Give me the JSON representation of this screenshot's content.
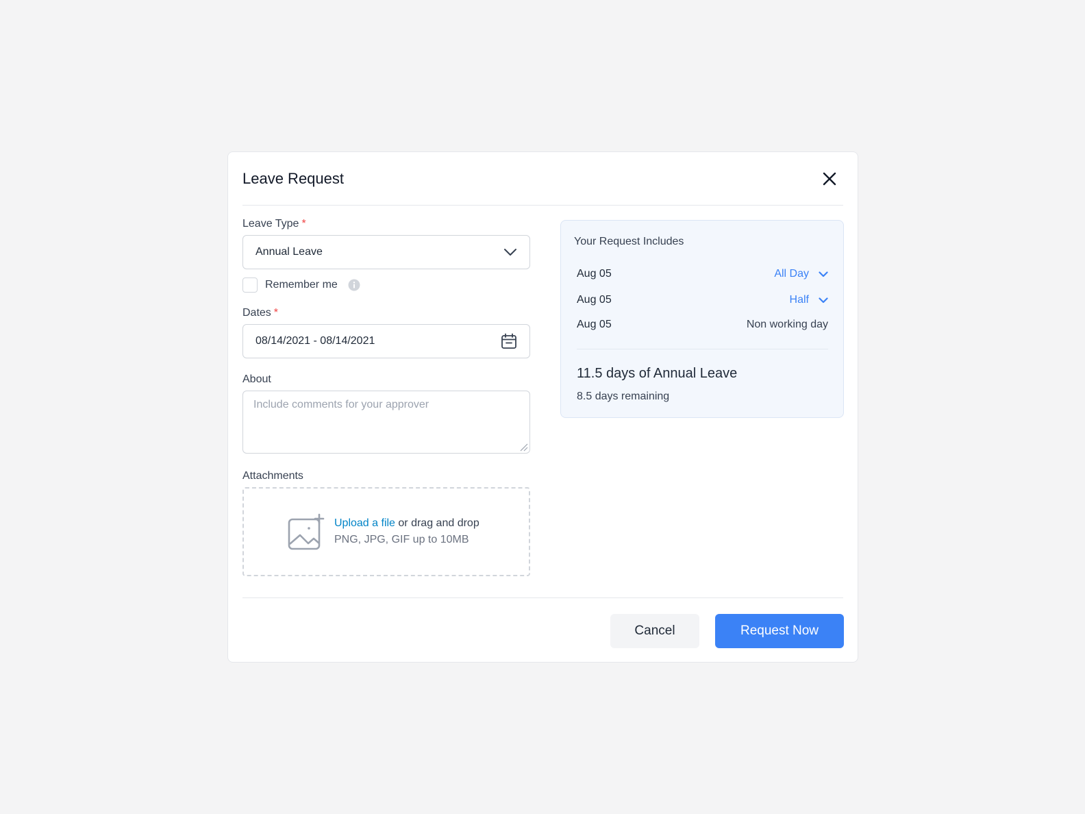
{
  "modal": {
    "title": "Leave Request"
  },
  "form": {
    "leave_type": {
      "label": "Leave Type",
      "required_mark": "*",
      "value": "Annual Leave"
    },
    "remember": {
      "label": "Remember me",
      "checked": false
    },
    "dates": {
      "label": "Dates",
      "required_mark": "*",
      "value": "08/14/2021 - 08/14/2021"
    },
    "about": {
      "label": "About",
      "placeholder": "Include comments for your approver"
    },
    "attachments": {
      "label": "Attachments",
      "upload_link": "Upload a file",
      "upload_rest": "or drag and drop",
      "hint": "PNG, JPG, GIF up to 10MB"
    }
  },
  "summary": {
    "title": "Your Request Includes",
    "days": [
      {
        "date": "Aug 05",
        "option": "All Day"
      },
      {
        "date": "Aug 05",
        "option": "Half"
      },
      {
        "date": "Aug 05",
        "status": "Non working day"
      }
    ],
    "total": "11.5 days of Annual Leave",
    "remaining": "8.5 days remaining"
  },
  "footer": {
    "cancel_label": "Cancel",
    "submit_label": "Request Now"
  },
  "colors": {
    "primary": "#3b82f6",
    "link": "#0284c7",
    "required": "#ef4444",
    "summary_bg": "#f3f7fd"
  },
  "icons": [
    "close-icon",
    "chevron-down-icon",
    "info-icon",
    "calendar-icon",
    "image-add-icon",
    "resize-grip-icon"
  ]
}
